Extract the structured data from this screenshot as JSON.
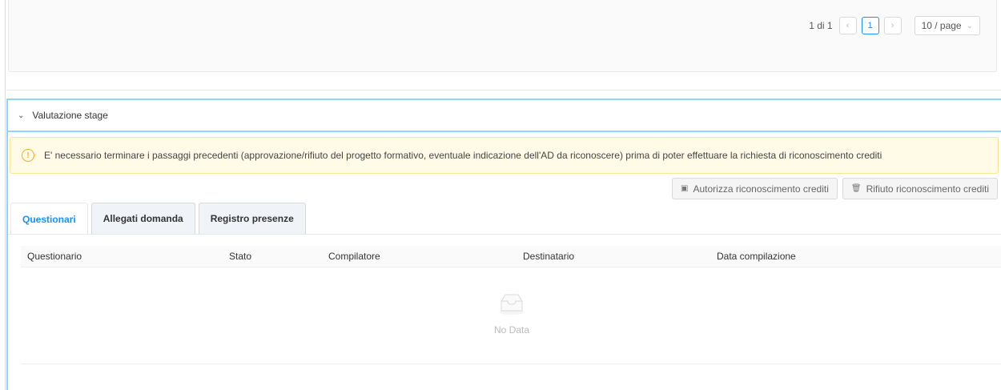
{
  "pagination": {
    "total_text": "1 di 1",
    "prev_icon": "chevron-left-icon",
    "current_page": "1",
    "next_icon": "chevron-right-icon",
    "page_size": "10 / page"
  },
  "section": {
    "title": "Valutazione stage",
    "toggle_icon": "chevron-down-icon"
  },
  "alert": {
    "icon": "warning-circle-icon",
    "text": "E' necessario terminare i passaggi precedenti (approvazione/rifiuto del progetto formativo, eventuale indicazione dell'AD da riconoscere) prima di poter effettuare la richiesta di riconoscimento crediti",
    "color": "#fffbe6"
  },
  "actions": {
    "authorize": {
      "label": "Autorizza riconoscimento crediti",
      "icon": "approve-icon"
    },
    "reject": {
      "label": "Rifiuto riconoscimento crediti",
      "icon": "trash-icon"
    }
  },
  "tabs": [
    {
      "label": "Questionari",
      "active": true
    },
    {
      "label": "Allegati domanda",
      "active": false
    },
    {
      "label": "Registro presenze",
      "active": false
    }
  ],
  "table": {
    "columns": [
      "Questionario",
      "Stato",
      "Compilatore",
      "Destinatario",
      "Data compilazione"
    ],
    "empty_text": "No Data",
    "empty_icon": "empty-inbox-icon"
  },
  "colors": {
    "accent": "#1890ff",
    "warning": "#faad14",
    "panel_border": "#91d5ff"
  }
}
